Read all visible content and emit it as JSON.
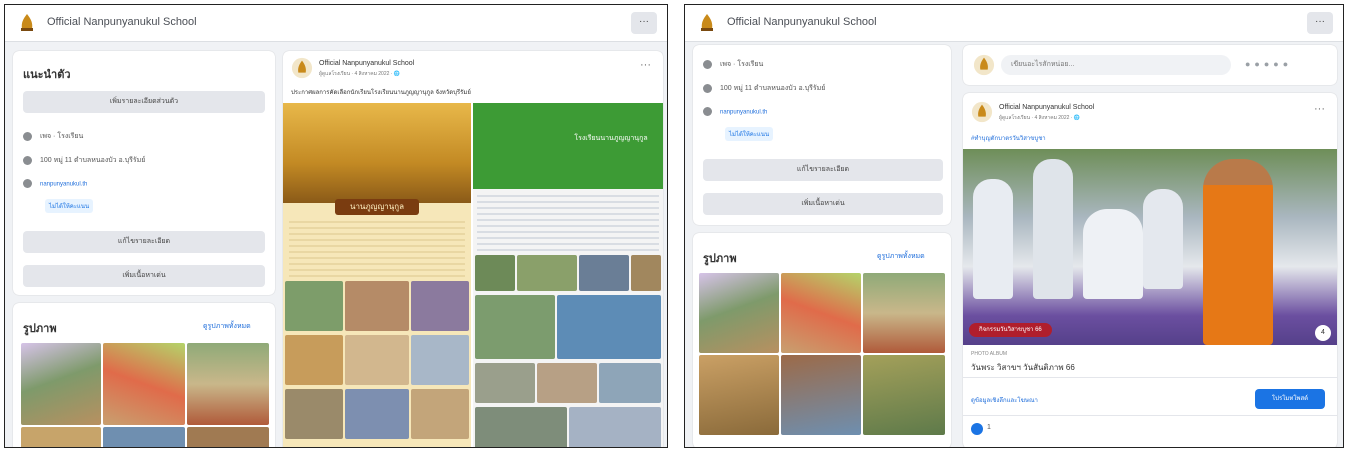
{
  "left": {
    "page_name": "Official Nanpunyanukul School",
    "menu_label": "···",
    "intro_title": "แนะนำตัว",
    "intro_button": "เพิ่มรายละเอียดส่วนตัว",
    "info_rows": [
      "เพจ · โรงเรียน",
      "100 หมู่ 11 ตำบลหนองบัว อ.บุรีรัมย์",
      "nanpunyanukul.th"
    ],
    "info_chip": "ไม่ได้ให้คะแนน",
    "btn_edit": "แก้ไขรายละเอียด",
    "btn_add": "เพิ่มเนื้อหาเด่น",
    "photos_title": "รูปภาพ",
    "photos_see_all": "ดูรูปภาพทั้งหมด",
    "post_page": "Official Nanpunyanukul School",
    "post_meta": "ผู้ดูแลโรงเรียน · 4 สิงหาคม 2022 · 🌐",
    "post_text": "ประกาศผลการคัดเลือกนักเรียนโรงเรียนนานภูญญานุกูล จังหวัดบุรีรัมย์",
    "banner_label": "นานภูญญานุกูล",
    "green_label": "โรงเรียนนานภูญญานุกูล"
  },
  "right": {
    "page_name": "Official Nanpunyanukul School",
    "menu_label": "···",
    "info_rows": [
      "เพจ · โรงเรียน",
      "100 หมู่ 11 ตำบลหนองบัว อ.บุรีรัมย์",
      "nanpunyanukul.th"
    ],
    "info_chip": "ไม่ได้ให้คะแนน",
    "btn_edit": "แก้ไขรายละเอียด",
    "btn_add": "เพิ่มเนื้อหาเด่น",
    "photos_title": "รูปภาพ",
    "photos_see_all": "ดูรูปภาพทั้งหมด",
    "composer_placeholder": "เขียนอะไรสักหน่อย...",
    "post_page": "Official Nanpunyanukul School",
    "post_meta": "ผู้ดูแลโรงเรียน · 4 สิงหาคม 2022 · 🌐",
    "post_link": "#ทำบุญตักบาตรวันวิสาขบูชา",
    "badge_text": "กิจกรรมวันวิสาขบูชา 66",
    "album_date": "PHOTO ALBUM",
    "album_title": "วันพระ วิสาขฯ วันสันติภาพ 66",
    "link_text": "ดูข้อมูลเชิงลึกและโฆษณา",
    "boost_btn": "โปรโมทโพสต์",
    "count_badge": "4",
    "reaction_count": "1"
  }
}
